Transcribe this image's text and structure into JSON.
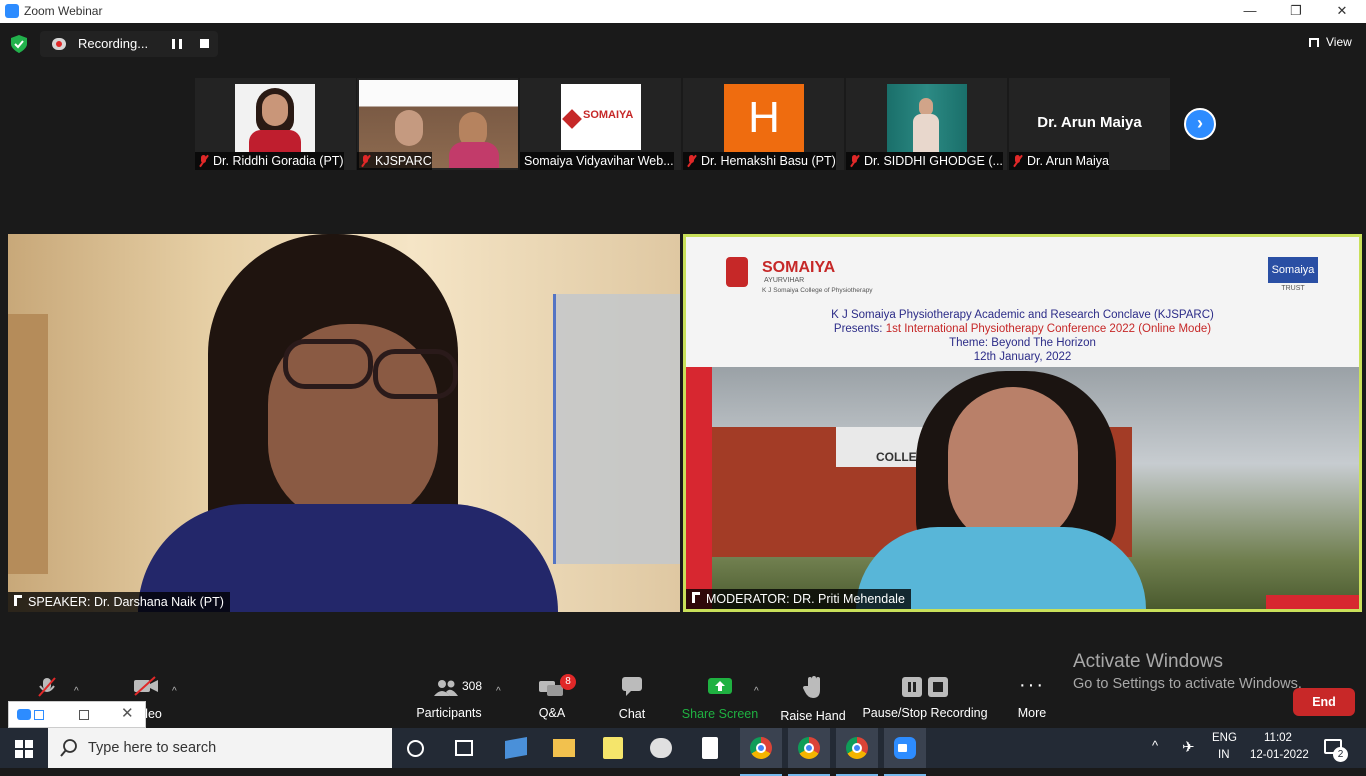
{
  "window": {
    "title": "Zoom Webinar",
    "minimize": "—",
    "restore": "❐",
    "close": "✕"
  },
  "topbar": {
    "recording_label": "Recording...",
    "view_label": "View"
  },
  "participants_strip": [
    {
      "name": "Dr. Riddhi Goradia (PT)"
    },
    {
      "name": "KJSPARC"
    },
    {
      "name": "Somaiya Vidyavihar Web..."
    },
    {
      "name": "Dr. Hemakshi Basu (PT)",
      "avatar_letter": "H"
    },
    {
      "name": "Dr. SIDDHI GHODGE (..."
    },
    {
      "name": "Dr. Arun Maiya",
      "display_name": "Dr. Arun Maiya"
    }
  ],
  "next_arrow": "›",
  "speaker": {
    "label": "SPEAKER: Dr. Darshana Naik (PT)"
  },
  "moderator": {
    "label": "MODERATOR: DR. Priti Mehendale"
  },
  "slide": {
    "logo_text": "SOMAIYA",
    "logo_sub": "AYURVIHAR",
    "logo_college": "K J Somaiya College of Physiotherapy",
    "trust_logo": "Somaiya",
    "trust_sub": "TRUST",
    "line1": "K J Somaiya Physiotherapy Academic and Research Conclave (KJSPARC)",
    "line2_prefix": "Presents: ",
    "line2_red": "1st International  Physiotherapy Conference 2022 (Online Mode)",
    "line3": "Theme: Beyond The Horizon",
    "line4": "12th January, 2022",
    "building_sign": "COLLEG"
  },
  "controls": {
    "mute": "",
    "video": "Video",
    "participants": "Participants",
    "participants_count": "308",
    "qa": "Q&A",
    "qa_badge": "8",
    "chat": "Chat",
    "share": "Share Screen",
    "raise_hand": "Raise Hand",
    "recording": "Pause/Stop Recording",
    "more": "More",
    "end": "End"
  },
  "watermark": {
    "line1": "Activate Windows",
    "line2": "Go to Settings to activate Windows."
  },
  "taskbar": {
    "search_placeholder": "Type here to search",
    "lang1": "ENG",
    "lang2": "IN",
    "time": "11:02",
    "date": "12-01-2022",
    "notifications": "2"
  },
  "colors": {
    "accent": "#2d8cff",
    "end": "#c82828",
    "share_green": "#1fb141",
    "active_speaker": "#c9e05a"
  }
}
